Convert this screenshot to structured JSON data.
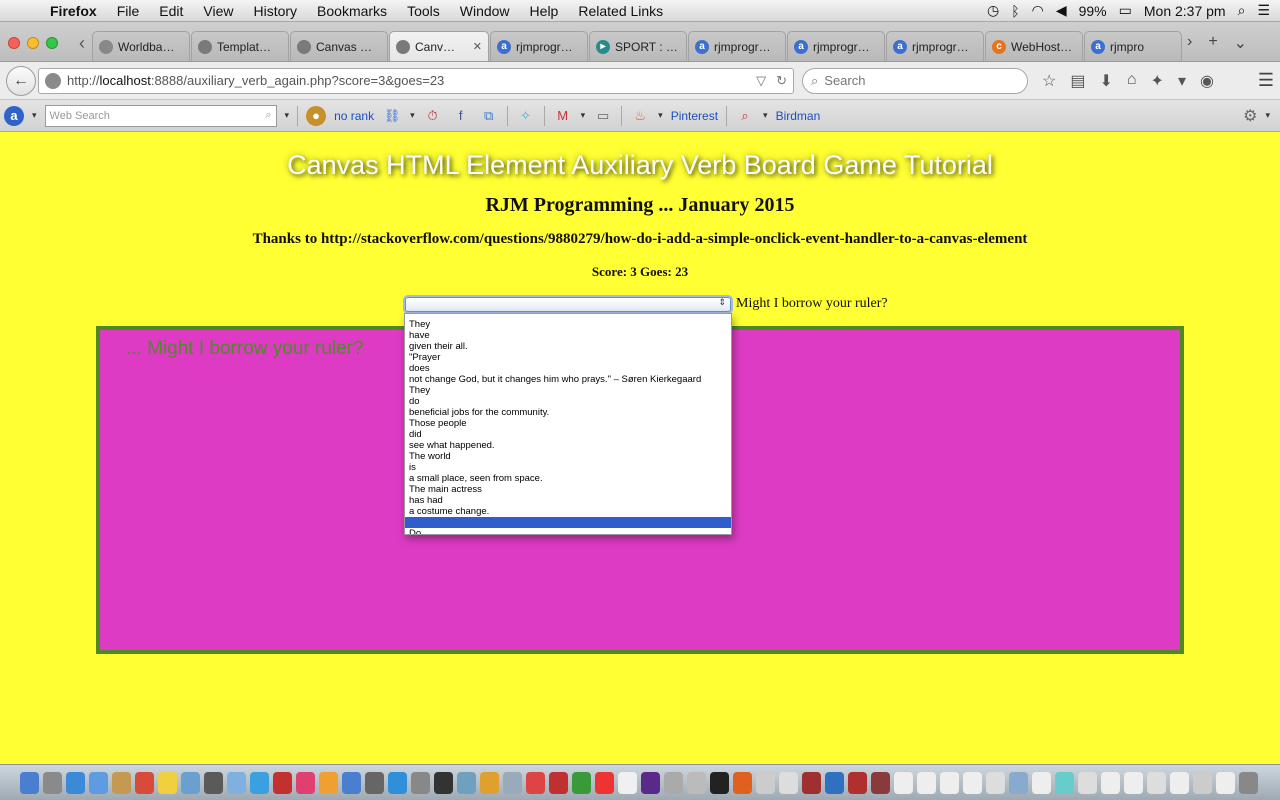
{
  "menubar": {
    "app": "Firefox",
    "items": [
      "File",
      "Edit",
      "View",
      "History",
      "Bookmarks",
      "Tools",
      "Window",
      "Help",
      "Related Links"
    ],
    "battery": "99%",
    "clock": "Mon 2:37 pm"
  },
  "tabs": [
    {
      "label": "Worldba…",
      "icon": "photo-icon",
      "color": "#888888",
      "glyph": ""
    },
    {
      "label": "Templat…",
      "icon": "globe-icon",
      "color": "#7a7a7a",
      "glyph": ""
    },
    {
      "label": "Canvas …",
      "icon": "globe-icon",
      "color": "#7a7a7a",
      "glyph": ""
    },
    {
      "label": "Canv…",
      "icon": "globe-icon",
      "color": "#7a7a7a",
      "glyph": "",
      "active": true
    },
    {
      "label": "rjmprogr…",
      "icon": "a-icon",
      "color": "#3b6fd1",
      "glyph": "a"
    },
    {
      "label": "SPORT : …",
      "icon": "play-icon",
      "color": "#2b8a8a",
      "glyph": "▸"
    },
    {
      "label": "rjmprogr…",
      "icon": "a-icon",
      "color": "#3b6fd1",
      "glyph": "a"
    },
    {
      "label": "rjmprogr…",
      "icon": "a-icon",
      "color": "#3b6fd1",
      "glyph": "a"
    },
    {
      "label": "rjmprogr…",
      "icon": "a-icon",
      "color": "#3b6fd1",
      "glyph": "a"
    },
    {
      "label": "WebHost…",
      "icon": "cpanel-icon",
      "color": "#e8731a",
      "glyph": "c"
    },
    {
      "label": "rjmpro",
      "icon": "a-icon",
      "color": "#3b6fd1",
      "glyph": "a"
    }
  ],
  "navbar": {
    "url_host": "localhost",
    "url_prefix": "http://",
    "url_rest": ":8888/auxiliary_verb_again.php?score=3&goes=23",
    "search_placeholder": "Search"
  },
  "bookmarks": {
    "websearch_placeholder": "Web Search",
    "no_rank": "no rank",
    "pinterest": "Pinterest",
    "birdman": "Birdman"
  },
  "page": {
    "title": "Canvas HTML Element Auxiliary Verb Board Game Tutorial",
    "subtitle": "RJM Programming ... January 2015",
    "thanks": "Thanks to http://stackoverflow.com/questions/9880279/how-do-i-add-a-simple-onclick-event-handler-to-a-canvas-element",
    "score_line": "Score: 3 Goes: 23",
    "question": "Might I borrow your ruler?",
    "canvas_text": "... Might I borrow your ruler?"
  },
  "dropdown": {
    "options": [
      "They",
      "have",
      "given their all.",
      "\"Prayer",
      "does",
      "not change God, but it changes him who prays.\" – Søren Kierkegaard",
      "They",
      "do",
      "beneficial jobs for the community.",
      "Those people",
      "did",
      "see what happened.",
      "The world",
      "is",
      "a small place, seen from space.",
      "The main actress",
      "has had",
      "a costume change.",
      "",
      "Do"
    ],
    "selected_index": 18
  },
  "colors": {
    "page_bg": "#ffff33",
    "canvas_fill": "#dd3bc4",
    "canvas_border": "#4e8a21",
    "selected_option": "#2f5dcb"
  }
}
